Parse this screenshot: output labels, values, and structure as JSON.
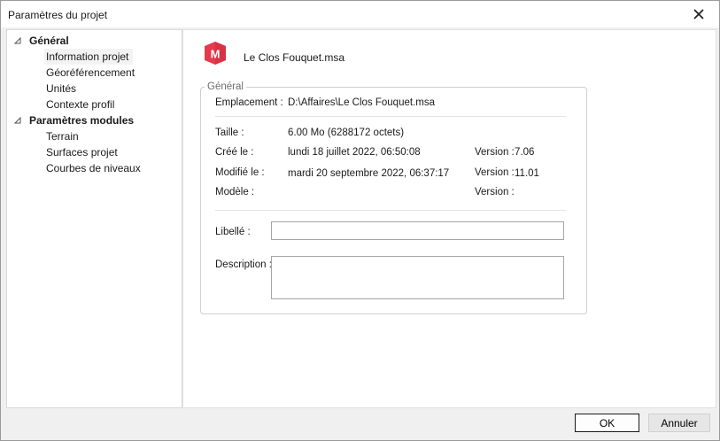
{
  "window": {
    "title": "Paramètres du projet"
  },
  "tree": {
    "groups": [
      {
        "label": "Général",
        "expanded": true,
        "items": [
          "Information projet",
          "Géoréférencement",
          "Unités",
          "Contexte profil"
        ],
        "selected_item": "Information projet"
      },
      {
        "label": "Paramètres modules",
        "expanded": true,
        "items": [
          "Terrain",
          "Surfaces projet",
          "Courbes de niveaux"
        ]
      }
    ]
  },
  "file": {
    "name": "Le Clos Fouquet.msa",
    "logo_letter": "M",
    "logo_color": "#e53a4c"
  },
  "general": {
    "title": "Général",
    "location_label": "Emplacement :",
    "location_value": "D:\\Affaires\\Le Clos Fouquet.msa",
    "size_label": "Taille :",
    "size_value": "6.00 Mo (6288172 octets)",
    "created_label": "Créé le :",
    "created_value": "lundi 18 juillet 2022, 06:50:08",
    "created_version_label": "Version :",
    "created_version_value": "7.06",
    "modified_label": "Modifié le :",
    "modified_value": "mardi 20 septembre 2022, 06:37:17",
    "modified_version_label": "Version :",
    "modified_version_value": "11.01",
    "model_label": "Modèle :",
    "model_version_label": "Version :",
    "libelle_label": "Libellé :",
    "libelle_value": "",
    "description_label": "Description :",
    "description_value": ""
  },
  "buttons": {
    "ok": "OK",
    "cancel": "Annuler"
  },
  "colors": {
    "accent": "#e53a4c",
    "selection": "#f3f3f3"
  }
}
